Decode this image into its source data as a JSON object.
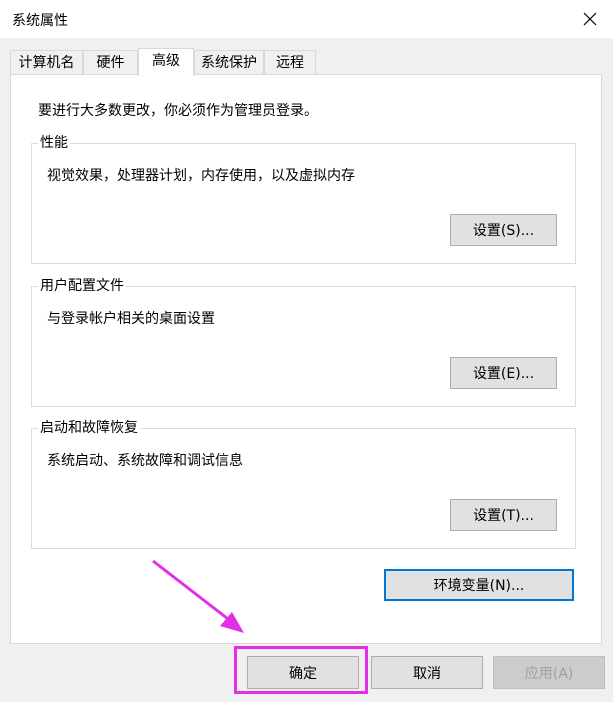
{
  "window": {
    "title": "系统属性",
    "close_icon": "close-icon"
  },
  "tabs": [
    {
      "label": "计算机名",
      "active": false
    },
    {
      "label": "硬件",
      "active": false
    },
    {
      "label": "高级",
      "active": true
    },
    {
      "label": "系统保护",
      "active": false
    },
    {
      "label": "远程",
      "active": false
    }
  ],
  "panel": {
    "admin_note": "要进行大多数更改，你必须作为管理员登录。",
    "performance": {
      "label": "性能",
      "description": "视觉效果，处理器计划，内存使用，以及虚拟内存",
      "button": "设置(S)..."
    },
    "user_profiles": {
      "label": "用户配置文件",
      "description": "与登录帐户相关的桌面设置",
      "button": "设置(E)..."
    },
    "startup_recovery": {
      "label": "启动和故障恢复",
      "description": "系统启动、系统故障和调试信息",
      "button": "设置(T)..."
    },
    "env_vars_button": "环境变量(N)..."
  },
  "footer": {
    "ok": "确定",
    "cancel": "取消",
    "apply": "应用(A)"
  },
  "annotation": {
    "highlight_color": "#e32ee8",
    "arrow_icon": "arrow-icon"
  },
  "colors": {
    "accent": "#0078d7",
    "highlight": "#e32ee8"
  }
}
